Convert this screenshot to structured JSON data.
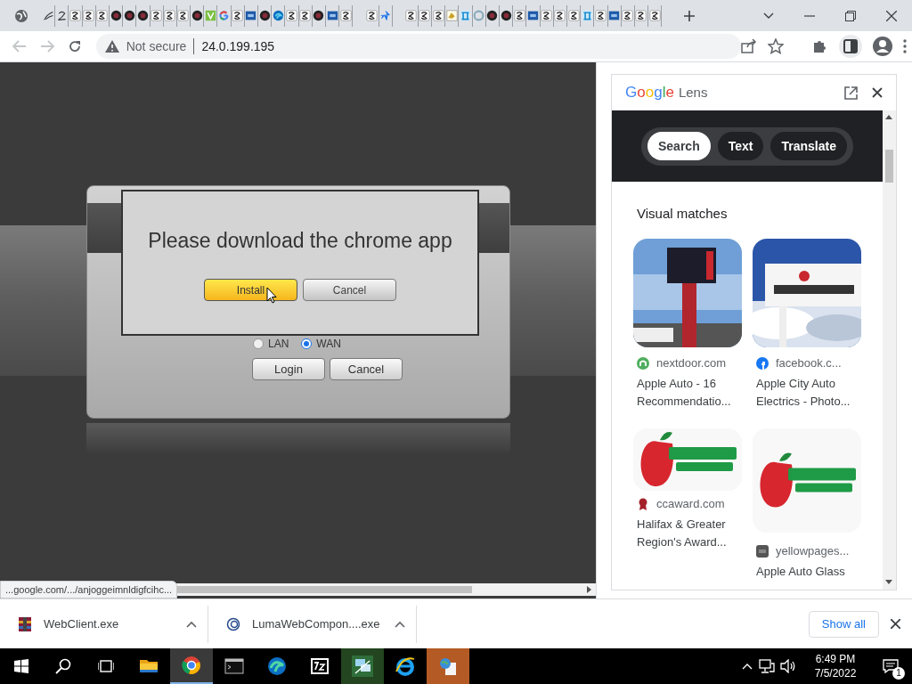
{
  "tab_strip": {
    "active_tab": {
      "kind": "globe"
    },
    "tab_groups": [
      {
        "tabs": [
          {
            "kind": "feather"
          },
          {
            "kind": "script"
          },
          {
            "kind": "spiral"
          },
          {
            "kind": "spiral"
          },
          {
            "kind": "spiral"
          },
          {
            "kind": "dark"
          },
          {
            "kind": "dark"
          },
          {
            "kind": "dark"
          },
          {
            "kind": "spiral"
          },
          {
            "kind": "spiral"
          },
          {
            "kind": "spiral"
          },
          {
            "kind": "dark"
          },
          {
            "kind": "green"
          },
          {
            "kind": "google"
          },
          {
            "kind": "spiral"
          },
          {
            "kind": "blue"
          },
          {
            "kind": "dark"
          },
          {
            "kind": "edge"
          },
          {
            "kind": "spiral"
          },
          {
            "kind": "spiral"
          },
          {
            "kind": "dark"
          },
          {
            "kind": "blue"
          },
          {
            "kind": "spiral"
          }
        ]
      },
      {
        "tabs": [
          {
            "kind": "spiral"
          },
          {
            "kind": "plane"
          }
        ]
      },
      {
        "tabs": [
          {
            "kind": "spiral"
          },
          {
            "kind": "spiral"
          },
          {
            "kind": "spiral"
          },
          {
            "kind": "gold"
          },
          {
            "kind": "pillar"
          },
          {
            "kind": "ring"
          },
          {
            "kind": "dark"
          },
          {
            "kind": "dark"
          },
          {
            "kind": "spiral"
          },
          {
            "kind": "blue"
          },
          {
            "kind": "spiral"
          },
          {
            "kind": "spiral"
          },
          {
            "kind": "spiral"
          },
          {
            "kind": "pillar"
          },
          {
            "kind": "spiral"
          },
          {
            "kind": "blue"
          },
          {
            "kind": "spiral"
          },
          {
            "kind": "spiral"
          },
          {
            "kind": "spiral"
          }
        ]
      }
    ]
  },
  "toolbar": {
    "security": "Not secure",
    "url": "24.0.199.195"
  },
  "page": {
    "login": {
      "radios": [
        {
          "label": "LAN",
          "selected": false
        },
        {
          "label": "WAN",
          "selected": true
        }
      ],
      "buttons": [
        "Login",
        "Cancel"
      ]
    },
    "dialog": {
      "message": "Please download the chrome app",
      "buttons": [
        {
          "label": "Install",
          "kind": "primary"
        },
        {
          "label": "Cancel",
          "kind": "secondary"
        }
      ]
    },
    "status_url": "...google.com/.../anjoggeimnldigfcihc..."
  },
  "lens": {
    "brand": "Google",
    "title": "Lens",
    "modes": [
      {
        "label": "Search",
        "selected": true
      },
      {
        "label": "Text",
        "selected": false
      },
      {
        "label": "Translate",
        "selected": false
      }
    ],
    "section": "Visual matches",
    "results": [
      {
        "source": "nextdoor.com",
        "title": "Apple Auto - 16 Recommendatio..."
      },
      {
        "source": "facebook.c...",
        "title": "Apple City Auto Electrics - Photo..."
      },
      {
        "source": "ccaward.com",
        "title": "Halifax & Greater Region's Award..."
      },
      {
        "source": "yellowpages...",
        "title": "Apple Auto Glass"
      }
    ]
  },
  "downloads": {
    "items": [
      {
        "name": "WebClient.exe"
      },
      {
        "name": "LumaWebCompon....exe"
      }
    ],
    "show_all": "Show all"
  },
  "taskbar": {
    "apps": [
      {
        "kind": "explorer",
        "selected": false
      },
      {
        "kind": "chrome",
        "selected": true
      },
      {
        "kind": "terminal",
        "selected": false
      },
      {
        "kind": "edge",
        "selected": false
      },
      {
        "kind": "zip",
        "selected": false
      },
      {
        "kind": "network",
        "selected": false
      },
      {
        "kind": "ie",
        "selected": false
      },
      {
        "kind": "globe-app",
        "selected": false
      }
    ],
    "time": "6:49 PM",
    "date": "7/5/2022",
    "notifications": "1"
  }
}
